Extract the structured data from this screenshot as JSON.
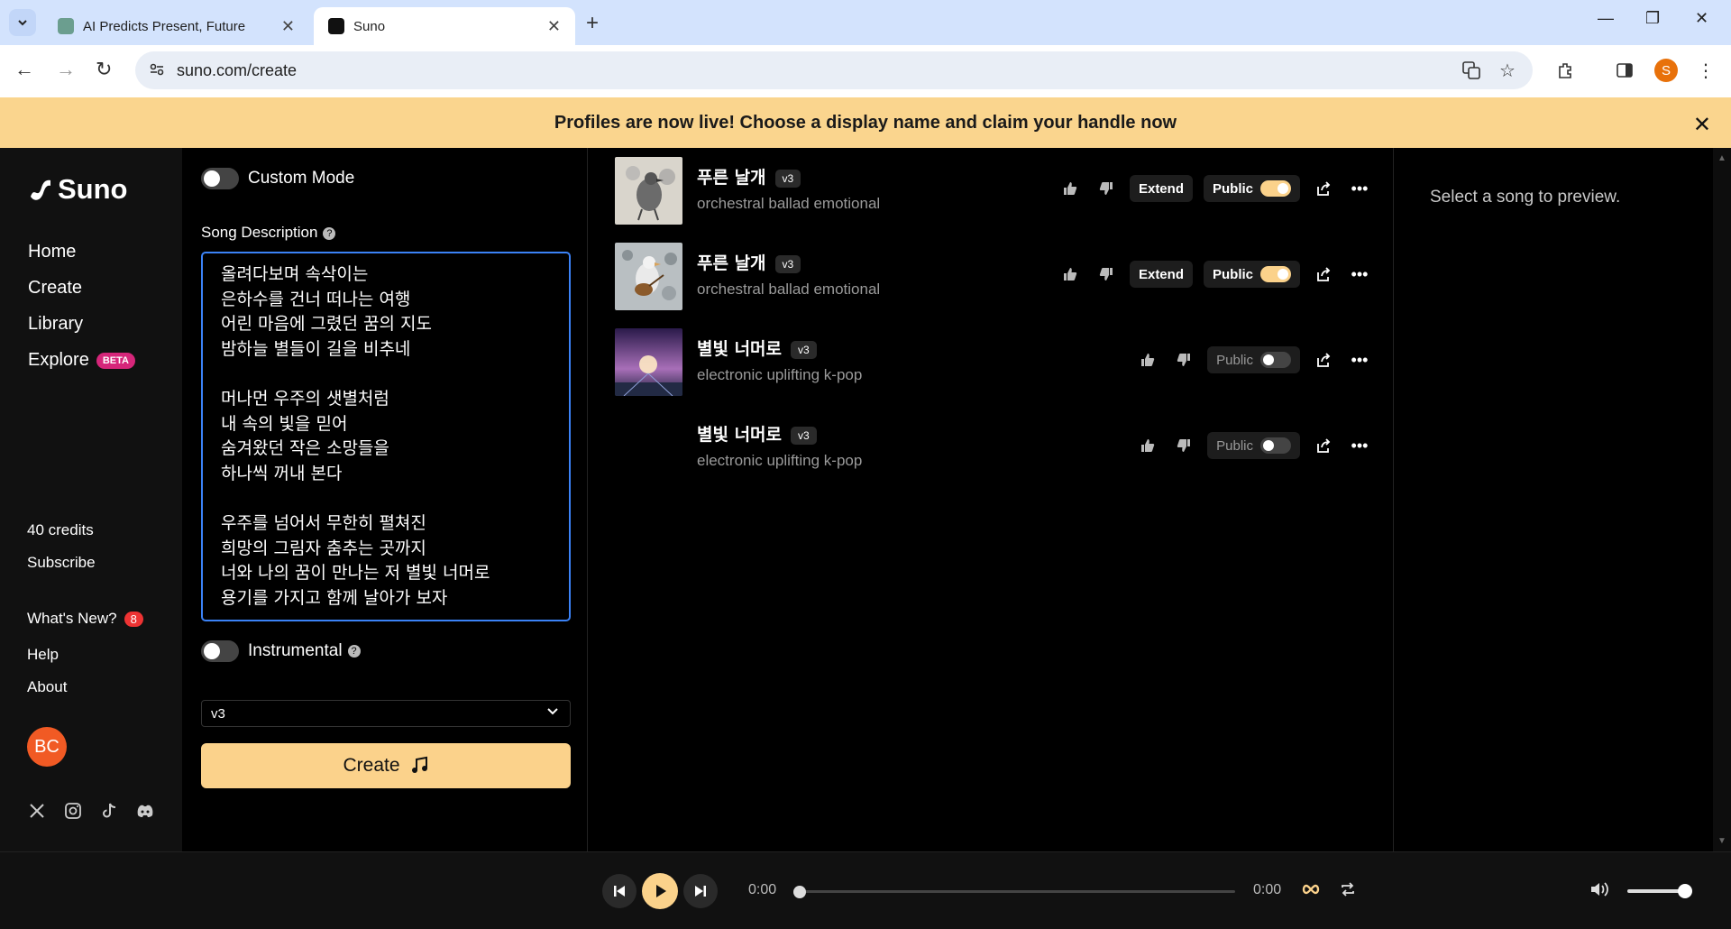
{
  "browser": {
    "tabs": [
      {
        "label": "AI Predicts Present, Future",
        "active": false
      },
      {
        "label": "Suno",
        "active": true
      }
    ],
    "url": "suno.com/create",
    "profile_initial": "S"
  },
  "banner": {
    "text": "Profiles are now live! Choose a display name and claim your handle now"
  },
  "sidebar": {
    "logo": "Suno",
    "nav": [
      "Home",
      "Create",
      "Library",
      "Explore"
    ],
    "beta_badge": "BETA",
    "credits": "40 credits",
    "subscribe": "Subscribe",
    "whats_new": "What's New?",
    "whats_new_count": "8",
    "help": "Help",
    "about": "About",
    "avatar_initials": "BC"
  },
  "create": {
    "custom_mode_label": "Custom Mode",
    "song_description_label": "Song Description",
    "lyrics": "올려다보며 속삭이는\n은하수를 건너 떠나는 여행\n어린 마음에 그렸던 꿈의 지도\n밤하늘 별들이 길을 비추네\n\n머나먼 우주의 샛별처럼\n내 속의 빛을 믿어\n숨겨왔던 작은 소망들을\n하나씩 꺼내 본다\n\n우주를 넘어서 무한히 펼쳐진\n희망의 그림자 춤추는 곳까지\n너와 나의 꿈이 만나는 저 별빛 너머로\n용기를 가지고 함께 날아가 보자",
    "instrumental_label": "Instrumental",
    "model_selected": "v3",
    "create_button": "Create"
  },
  "songs": [
    {
      "title": "푸른 날개",
      "version": "v3",
      "style": "orchestral ballad emotional",
      "has_extend": true,
      "extend_label": "Extend",
      "public_label": "Public",
      "public": true
    },
    {
      "title": "푸른 날개",
      "version": "v3",
      "style": "orchestral ballad emotional",
      "has_extend": true,
      "extend_label": "Extend",
      "public_label": "Public",
      "public": true
    },
    {
      "title": "별빛 너머로",
      "version": "v3",
      "style": "electronic uplifting k-pop",
      "has_extend": false,
      "public_label": "Public",
      "public": false
    },
    {
      "title": "별빛 너머로",
      "version": "v3",
      "style": "electronic uplifting k-pop",
      "has_extend": false,
      "public_label": "Public",
      "public": false
    }
  ],
  "preview": {
    "placeholder": "Select a song to preview."
  },
  "player": {
    "current_time": "0:00",
    "duration": "0:00",
    "progress": 0,
    "volume": 0.9
  },
  "colors": {
    "accent": "#fbd28b",
    "banner": "#fad58e",
    "beta": "#d6267a",
    "avatar": "#f15a24"
  }
}
